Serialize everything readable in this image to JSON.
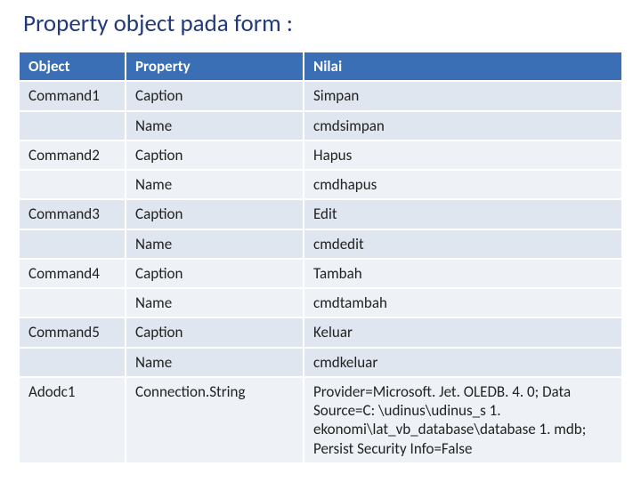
{
  "title": "Property object pada form :",
  "headers": {
    "object": "Object",
    "property": "Property",
    "nilai": "Nilai"
  },
  "rows": [
    {
      "object": "Command1",
      "property": "Caption",
      "nilai": "Simpan"
    },
    {
      "object": "",
      "property": "Name",
      "nilai": "cmdsimpan"
    },
    {
      "object": "Command2",
      "property": "Caption",
      "nilai": "Hapus"
    },
    {
      "object": "",
      "property": "Name",
      "nilai": "cmdhapus"
    },
    {
      "object": "Command3",
      "property": "Caption",
      "nilai": "Edit"
    },
    {
      "object": "",
      "property": "Name",
      "nilai": "cmdedit"
    },
    {
      "object": "Command4",
      "property": "Caption",
      "nilai": "Tambah"
    },
    {
      "object": "",
      "property": "Name",
      "nilai": "cmdtambah"
    },
    {
      "object": "Command5",
      "property": "Caption",
      "nilai": "Keluar"
    },
    {
      "object": "",
      "property": "Name",
      "nilai": "cmdkeluar"
    },
    {
      "object": "Adodc1",
      "property": "Connection.String",
      "nilai": "Provider=Microsoft. Jet. OLEDB. 4. 0; Data Source=C: \\udinus\\udinus_s 1. ekonomi\\lat_vb_database\\database 1. mdb; Persist Security Info=False"
    }
  ],
  "chart_data": {
    "type": "table",
    "title": "Property object pada form :",
    "columns": [
      "Object",
      "Property",
      "Nilai"
    ],
    "rows": [
      [
        "Command1",
        "Caption",
        "Simpan"
      ],
      [
        "",
        "Name",
        "cmdsimpan"
      ],
      [
        "Command2",
        "Caption",
        "Hapus"
      ],
      [
        "",
        "Name",
        "cmdhapus"
      ],
      [
        "Command3",
        "Caption",
        "Edit"
      ],
      [
        "",
        "Name",
        "cmdedit"
      ],
      [
        "Command4",
        "Caption",
        "Tambah"
      ],
      [
        "",
        "Name",
        "cmdtambah"
      ],
      [
        "Command5",
        "Caption",
        "Keluar"
      ],
      [
        "",
        "Name",
        "cmdkeluar"
      ],
      [
        "Adodc1",
        "Connection.String",
        "Provider=Microsoft. Jet. OLEDB. 4. 0; Data Source=C: \\udinus\\udinus_s 1. ekonomi\\lat_vb_database\\database 1. mdb; Persist Security Info=False"
      ]
    ]
  }
}
